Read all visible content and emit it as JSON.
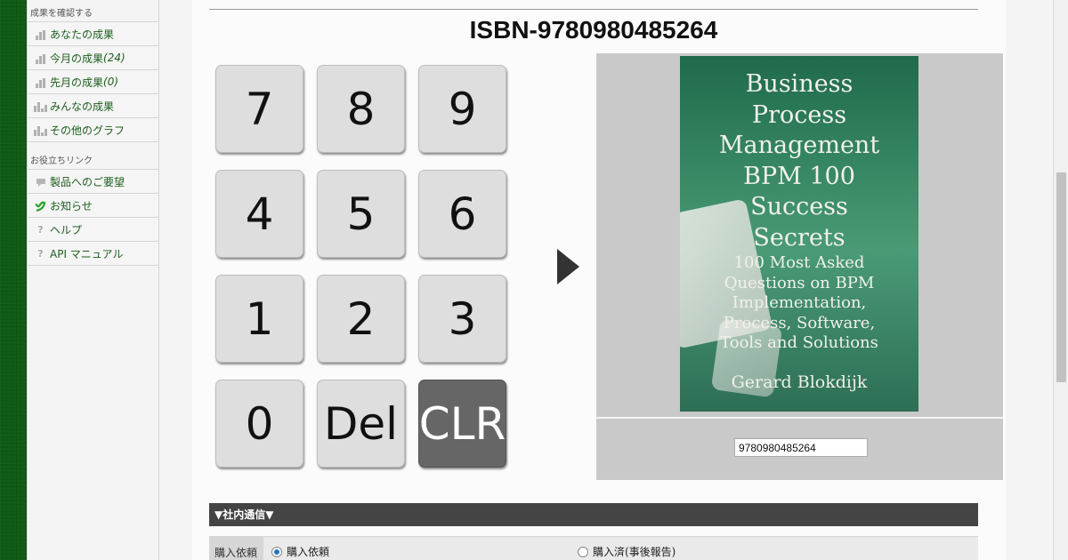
{
  "sidebar": {
    "section1_title": "成果を確認する",
    "section1_items": [
      {
        "label": "あなたの成果",
        "count": "",
        "icon": "bar-chart-icon"
      },
      {
        "label": "今月の成果",
        "count": "(24)",
        "icon": "bar-chart-icon"
      },
      {
        "label": "先月の成果",
        "count": "(0)",
        "icon": "bar-chart-icon"
      },
      {
        "label": "みんなの成果",
        "count": "",
        "icon": "group-chart-icon"
      },
      {
        "label": "その他のグラフ",
        "count": "",
        "icon": "group-chart-icon"
      }
    ],
    "section2_title": "お役立ちリンク",
    "section2_items": [
      {
        "label": "製品へのご要望",
        "icon": "feedback-icon"
      },
      {
        "label": "お知らせ",
        "icon": "notice-icon"
      },
      {
        "label": "ヘルプ",
        "icon": "help-icon"
      },
      {
        "label": "API マニュアル",
        "icon": "help-icon"
      }
    ]
  },
  "main": {
    "isbn_title": "ISBN-9780980485264",
    "keypad": [
      {
        "label": "7"
      },
      {
        "label": "8"
      },
      {
        "label": "9"
      },
      {
        "label": "4"
      },
      {
        "label": "5"
      },
      {
        "label": "6"
      },
      {
        "label": "1"
      },
      {
        "label": "2"
      },
      {
        "label": "3"
      },
      {
        "label": "0"
      },
      {
        "label": "Del"
      },
      {
        "label": "CLR"
      }
    ],
    "book": {
      "title_lines": [
        "Business",
        "Process",
        "Management",
        "BPM 100",
        "Success",
        "Secrets"
      ],
      "subtitle_lines": [
        "100 Most Asked",
        "Questions on BPM",
        "Implementation,",
        "Process, Software,",
        "Tools and Solutions"
      ],
      "author": "Gerard Blokdijk"
    },
    "isbn_input_value": "9780980485264",
    "section_bar": "▼社内通信▼",
    "purchase": {
      "label": "購入依頼",
      "options": [
        {
          "label": "購入依頼",
          "selected": true
        },
        {
          "label": "購入済(事後報告)",
          "selected": false
        }
      ]
    }
  },
  "colors": {
    "background": "#0f5a17",
    "clr_key": "#666666",
    "section_bar": "#444444",
    "link_green": "#1d5e1d"
  }
}
